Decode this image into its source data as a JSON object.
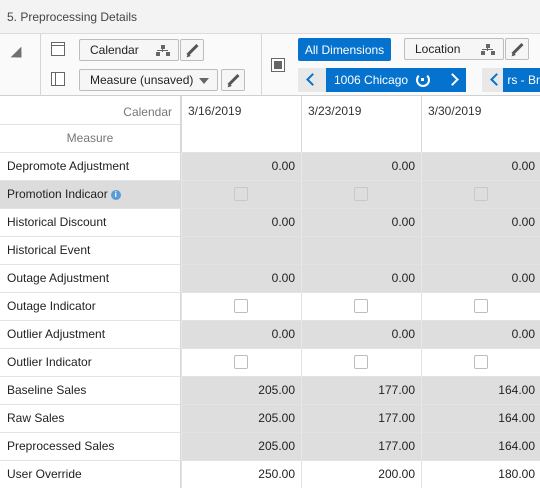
{
  "title": "5. Preprocessing Details",
  "toolbar": {
    "row_dimension": "Calendar",
    "column_dimension": "Measure (unsaved)",
    "all_dimensions": "All Dimensions",
    "page_dimension": "Location",
    "page_value": "1006 Chicago",
    "page_next_partial": "rs - Br"
  },
  "grid": {
    "header_calendar": "Calendar",
    "header_measure": "Measure",
    "columns": [
      "3/16/2019",
      "3/23/2019",
      "3/30/2019"
    ],
    "rows": [
      {
        "label": "Depromote Adjustment",
        "kind": "value",
        "editable": false,
        "values": [
          "0.00",
          "0.00",
          "0.00"
        ]
      },
      {
        "label": "Promotion Indicaor",
        "kind": "checkbox",
        "editable": false,
        "info": true,
        "selected": true,
        "values": [
          "",
          "",
          ""
        ]
      },
      {
        "label": "Historical Discount",
        "kind": "value",
        "editable": false,
        "values": [
          "0.00",
          "0.00",
          "0.00"
        ]
      },
      {
        "label": "Historical Event",
        "kind": "value",
        "editable": false,
        "values": [
          "",
          "",
          ""
        ]
      },
      {
        "label": "Outage Adjustment",
        "kind": "value",
        "editable": false,
        "values": [
          "0.00",
          "0.00",
          "0.00"
        ]
      },
      {
        "label": "Outage Indicator",
        "kind": "checkbox",
        "editable": true,
        "values": [
          "",
          "",
          ""
        ]
      },
      {
        "label": "Outlier Adjustment",
        "kind": "value",
        "editable": false,
        "values": [
          "0.00",
          "0.00",
          "0.00"
        ]
      },
      {
        "label": "Outlier Indicator",
        "kind": "checkbox",
        "editable": true,
        "values": [
          "",
          "",
          ""
        ]
      },
      {
        "label": "Baseline Sales",
        "kind": "value",
        "editable": false,
        "values": [
          "205.00",
          "177.00",
          "164.00"
        ]
      },
      {
        "label": "Raw Sales",
        "kind": "value",
        "editable": false,
        "values": [
          "205.00",
          "177.00",
          "164.00"
        ]
      },
      {
        "label": "Preprocessed Sales",
        "kind": "value",
        "editable": false,
        "values": [
          "205.00",
          "177.00",
          "164.00"
        ]
      },
      {
        "label": "User Override",
        "kind": "value",
        "editable": true,
        "values": [
          "250.00",
          "200.00",
          "180.00"
        ]
      }
    ]
  },
  "colors": {
    "accent": "#0572ce",
    "readonly_cell": "#dedede",
    "selected_row": "#dcdcdc"
  }
}
